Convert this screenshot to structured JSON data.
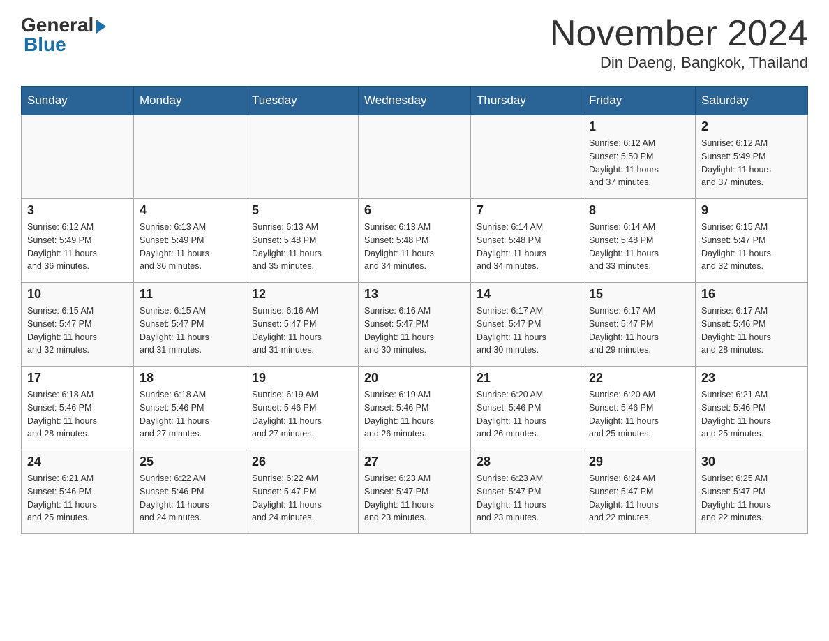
{
  "header": {
    "logo_general": "General",
    "logo_blue": "Blue",
    "title": "November 2024",
    "subtitle": "Din Daeng, Bangkok, Thailand"
  },
  "weekdays": [
    "Sunday",
    "Monday",
    "Tuesday",
    "Wednesday",
    "Thursday",
    "Friday",
    "Saturday"
  ],
  "weeks": [
    [
      {
        "day": "",
        "info": ""
      },
      {
        "day": "",
        "info": ""
      },
      {
        "day": "",
        "info": ""
      },
      {
        "day": "",
        "info": ""
      },
      {
        "day": "",
        "info": ""
      },
      {
        "day": "1",
        "info": "Sunrise: 6:12 AM\nSunset: 5:50 PM\nDaylight: 11 hours\nand 37 minutes."
      },
      {
        "day": "2",
        "info": "Sunrise: 6:12 AM\nSunset: 5:49 PM\nDaylight: 11 hours\nand 37 minutes."
      }
    ],
    [
      {
        "day": "3",
        "info": "Sunrise: 6:12 AM\nSunset: 5:49 PM\nDaylight: 11 hours\nand 36 minutes."
      },
      {
        "day": "4",
        "info": "Sunrise: 6:13 AM\nSunset: 5:49 PM\nDaylight: 11 hours\nand 36 minutes."
      },
      {
        "day": "5",
        "info": "Sunrise: 6:13 AM\nSunset: 5:48 PM\nDaylight: 11 hours\nand 35 minutes."
      },
      {
        "day": "6",
        "info": "Sunrise: 6:13 AM\nSunset: 5:48 PM\nDaylight: 11 hours\nand 34 minutes."
      },
      {
        "day": "7",
        "info": "Sunrise: 6:14 AM\nSunset: 5:48 PM\nDaylight: 11 hours\nand 34 minutes."
      },
      {
        "day": "8",
        "info": "Sunrise: 6:14 AM\nSunset: 5:48 PM\nDaylight: 11 hours\nand 33 minutes."
      },
      {
        "day": "9",
        "info": "Sunrise: 6:15 AM\nSunset: 5:47 PM\nDaylight: 11 hours\nand 32 minutes."
      }
    ],
    [
      {
        "day": "10",
        "info": "Sunrise: 6:15 AM\nSunset: 5:47 PM\nDaylight: 11 hours\nand 32 minutes."
      },
      {
        "day": "11",
        "info": "Sunrise: 6:15 AM\nSunset: 5:47 PM\nDaylight: 11 hours\nand 31 minutes."
      },
      {
        "day": "12",
        "info": "Sunrise: 6:16 AM\nSunset: 5:47 PM\nDaylight: 11 hours\nand 31 minutes."
      },
      {
        "day": "13",
        "info": "Sunrise: 6:16 AM\nSunset: 5:47 PM\nDaylight: 11 hours\nand 30 minutes."
      },
      {
        "day": "14",
        "info": "Sunrise: 6:17 AM\nSunset: 5:47 PM\nDaylight: 11 hours\nand 30 minutes."
      },
      {
        "day": "15",
        "info": "Sunrise: 6:17 AM\nSunset: 5:47 PM\nDaylight: 11 hours\nand 29 minutes."
      },
      {
        "day": "16",
        "info": "Sunrise: 6:17 AM\nSunset: 5:46 PM\nDaylight: 11 hours\nand 28 minutes."
      }
    ],
    [
      {
        "day": "17",
        "info": "Sunrise: 6:18 AM\nSunset: 5:46 PM\nDaylight: 11 hours\nand 28 minutes."
      },
      {
        "day": "18",
        "info": "Sunrise: 6:18 AM\nSunset: 5:46 PM\nDaylight: 11 hours\nand 27 minutes."
      },
      {
        "day": "19",
        "info": "Sunrise: 6:19 AM\nSunset: 5:46 PM\nDaylight: 11 hours\nand 27 minutes."
      },
      {
        "day": "20",
        "info": "Sunrise: 6:19 AM\nSunset: 5:46 PM\nDaylight: 11 hours\nand 26 minutes."
      },
      {
        "day": "21",
        "info": "Sunrise: 6:20 AM\nSunset: 5:46 PM\nDaylight: 11 hours\nand 26 minutes."
      },
      {
        "day": "22",
        "info": "Sunrise: 6:20 AM\nSunset: 5:46 PM\nDaylight: 11 hours\nand 25 minutes."
      },
      {
        "day": "23",
        "info": "Sunrise: 6:21 AM\nSunset: 5:46 PM\nDaylight: 11 hours\nand 25 minutes."
      }
    ],
    [
      {
        "day": "24",
        "info": "Sunrise: 6:21 AM\nSunset: 5:46 PM\nDaylight: 11 hours\nand 25 minutes."
      },
      {
        "day": "25",
        "info": "Sunrise: 6:22 AM\nSunset: 5:46 PM\nDaylight: 11 hours\nand 24 minutes."
      },
      {
        "day": "26",
        "info": "Sunrise: 6:22 AM\nSunset: 5:47 PM\nDaylight: 11 hours\nand 24 minutes."
      },
      {
        "day": "27",
        "info": "Sunrise: 6:23 AM\nSunset: 5:47 PM\nDaylight: 11 hours\nand 23 minutes."
      },
      {
        "day": "28",
        "info": "Sunrise: 6:23 AM\nSunset: 5:47 PM\nDaylight: 11 hours\nand 23 minutes."
      },
      {
        "day": "29",
        "info": "Sunrise: 6:24 AM\nSunset: 5:47 PM\nDaylight: 11 hours\nand 22 minutes."
      },
      {
        "day": "30",
        "info": "Sunrise: 6:25 AM\nSunset: 5:47 PM\nDaylight: 11 hours\nand 22 minutes."
      }
    ]
  ]
}
